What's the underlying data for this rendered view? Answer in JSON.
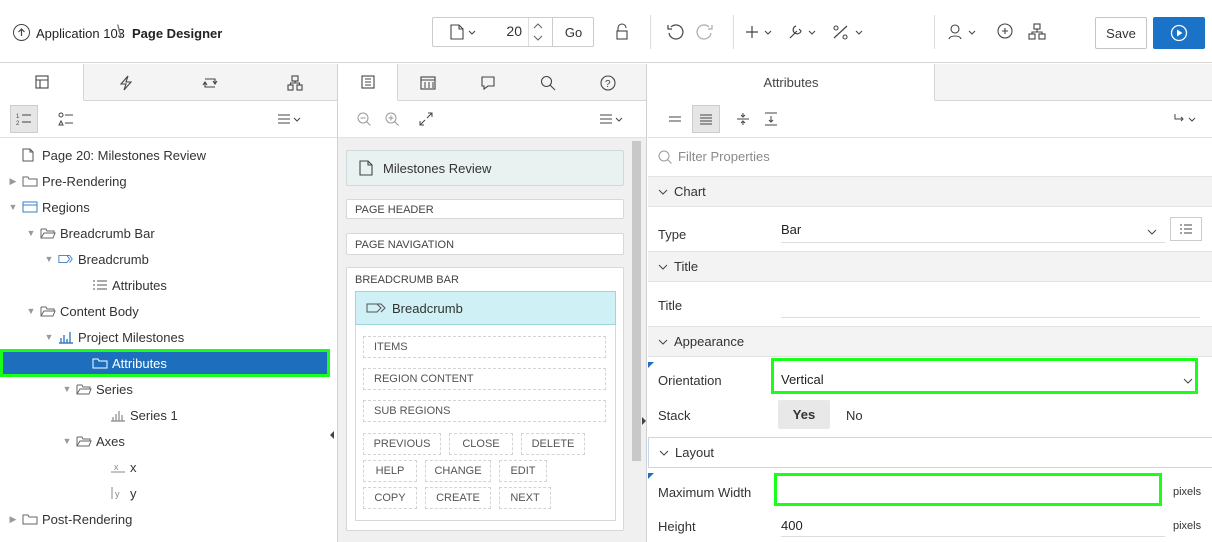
{
  "header": {
    "app_name": "Application 103",
    "crumb_separator": "\\",
    "current_page": "Page Designer",
    "page_number": "20",
    "go_label": "Go",
    "save_label": "Save"
  },
  "left_tree": {
    "rows": [
      {
        "label": "Page 20: Milestones Review"
      },
      {
        "label": "Pre-Rendering"
      },
      {
        "label": "Regions"
      },
      {
        "label": "Breadcrumb Bar"
      },
      {
        "label": "Breadcrumb"
      },
      {
        "label": "Attributes"
      },
      {
        "label": "Content Body"
      },
      {
        "label": "Project Milestones"
      },
      {
        "label": "Attributes"
      },
      {
        "label": "Series"
      },
      {
        "label": "Series 1"
      },
      {
        "label": "Axes"
      },
      {
        "label": "x"
      },
      {
        "label": "y"
      },
      {
        "label": "Post-Rendering"
      }
    ]
  },
  "layout_panel": {
    "page_title": "Milestones Review",
    "page_header": "PAGE HEADER",
    "page_navigation": "PAGE NAVIGATION",
    "breadcrumb_bar": "BREADCRUMB BAR",
    "breadcrumb_region": "Breadcrumb",
    "items": "ITEMS",
    "region_content": "REGION CONTENT",
    "sub_regions": "SUB REGIONS",
    "buttons": [
      "PREVIOUS",
      "CLOSE",
      "DELETE",
      "HELP",
      "CHANGE",
      "EDIT",
      "COPY",
      "CREATE",
      "NEXT"
    ]
  },
  "property_editor": {
    "tab_label": "Attributes",
    "filter_placeholder": "Filter Properties",
    "sections": {
      "chart": "Chart",
      "title": "Title",
      "appearance": "Appearance",
      "layout": "Layout"
    },
    "type_label": "Type",
    "type_value": "Bar",
    "title_label": "Title",
    "orientation_label": "Orientation",
    "orientation_value": "Vertical",
    "stack_label": "Stack",
    "stack_yes": "Yes",
    "stack_no": "No",
    "max_width_label": "Maximum Width",
    "max_width_unit": "pixels",
    "height_label": "Height",
    "height_value": "400",
    "height_unit": "pixels"
  },
  "colors": {
    "selection": "#1d6fbd",
    "highlight": "#1aff1a",
    "run_button": "#1a73c7"
  }
}
